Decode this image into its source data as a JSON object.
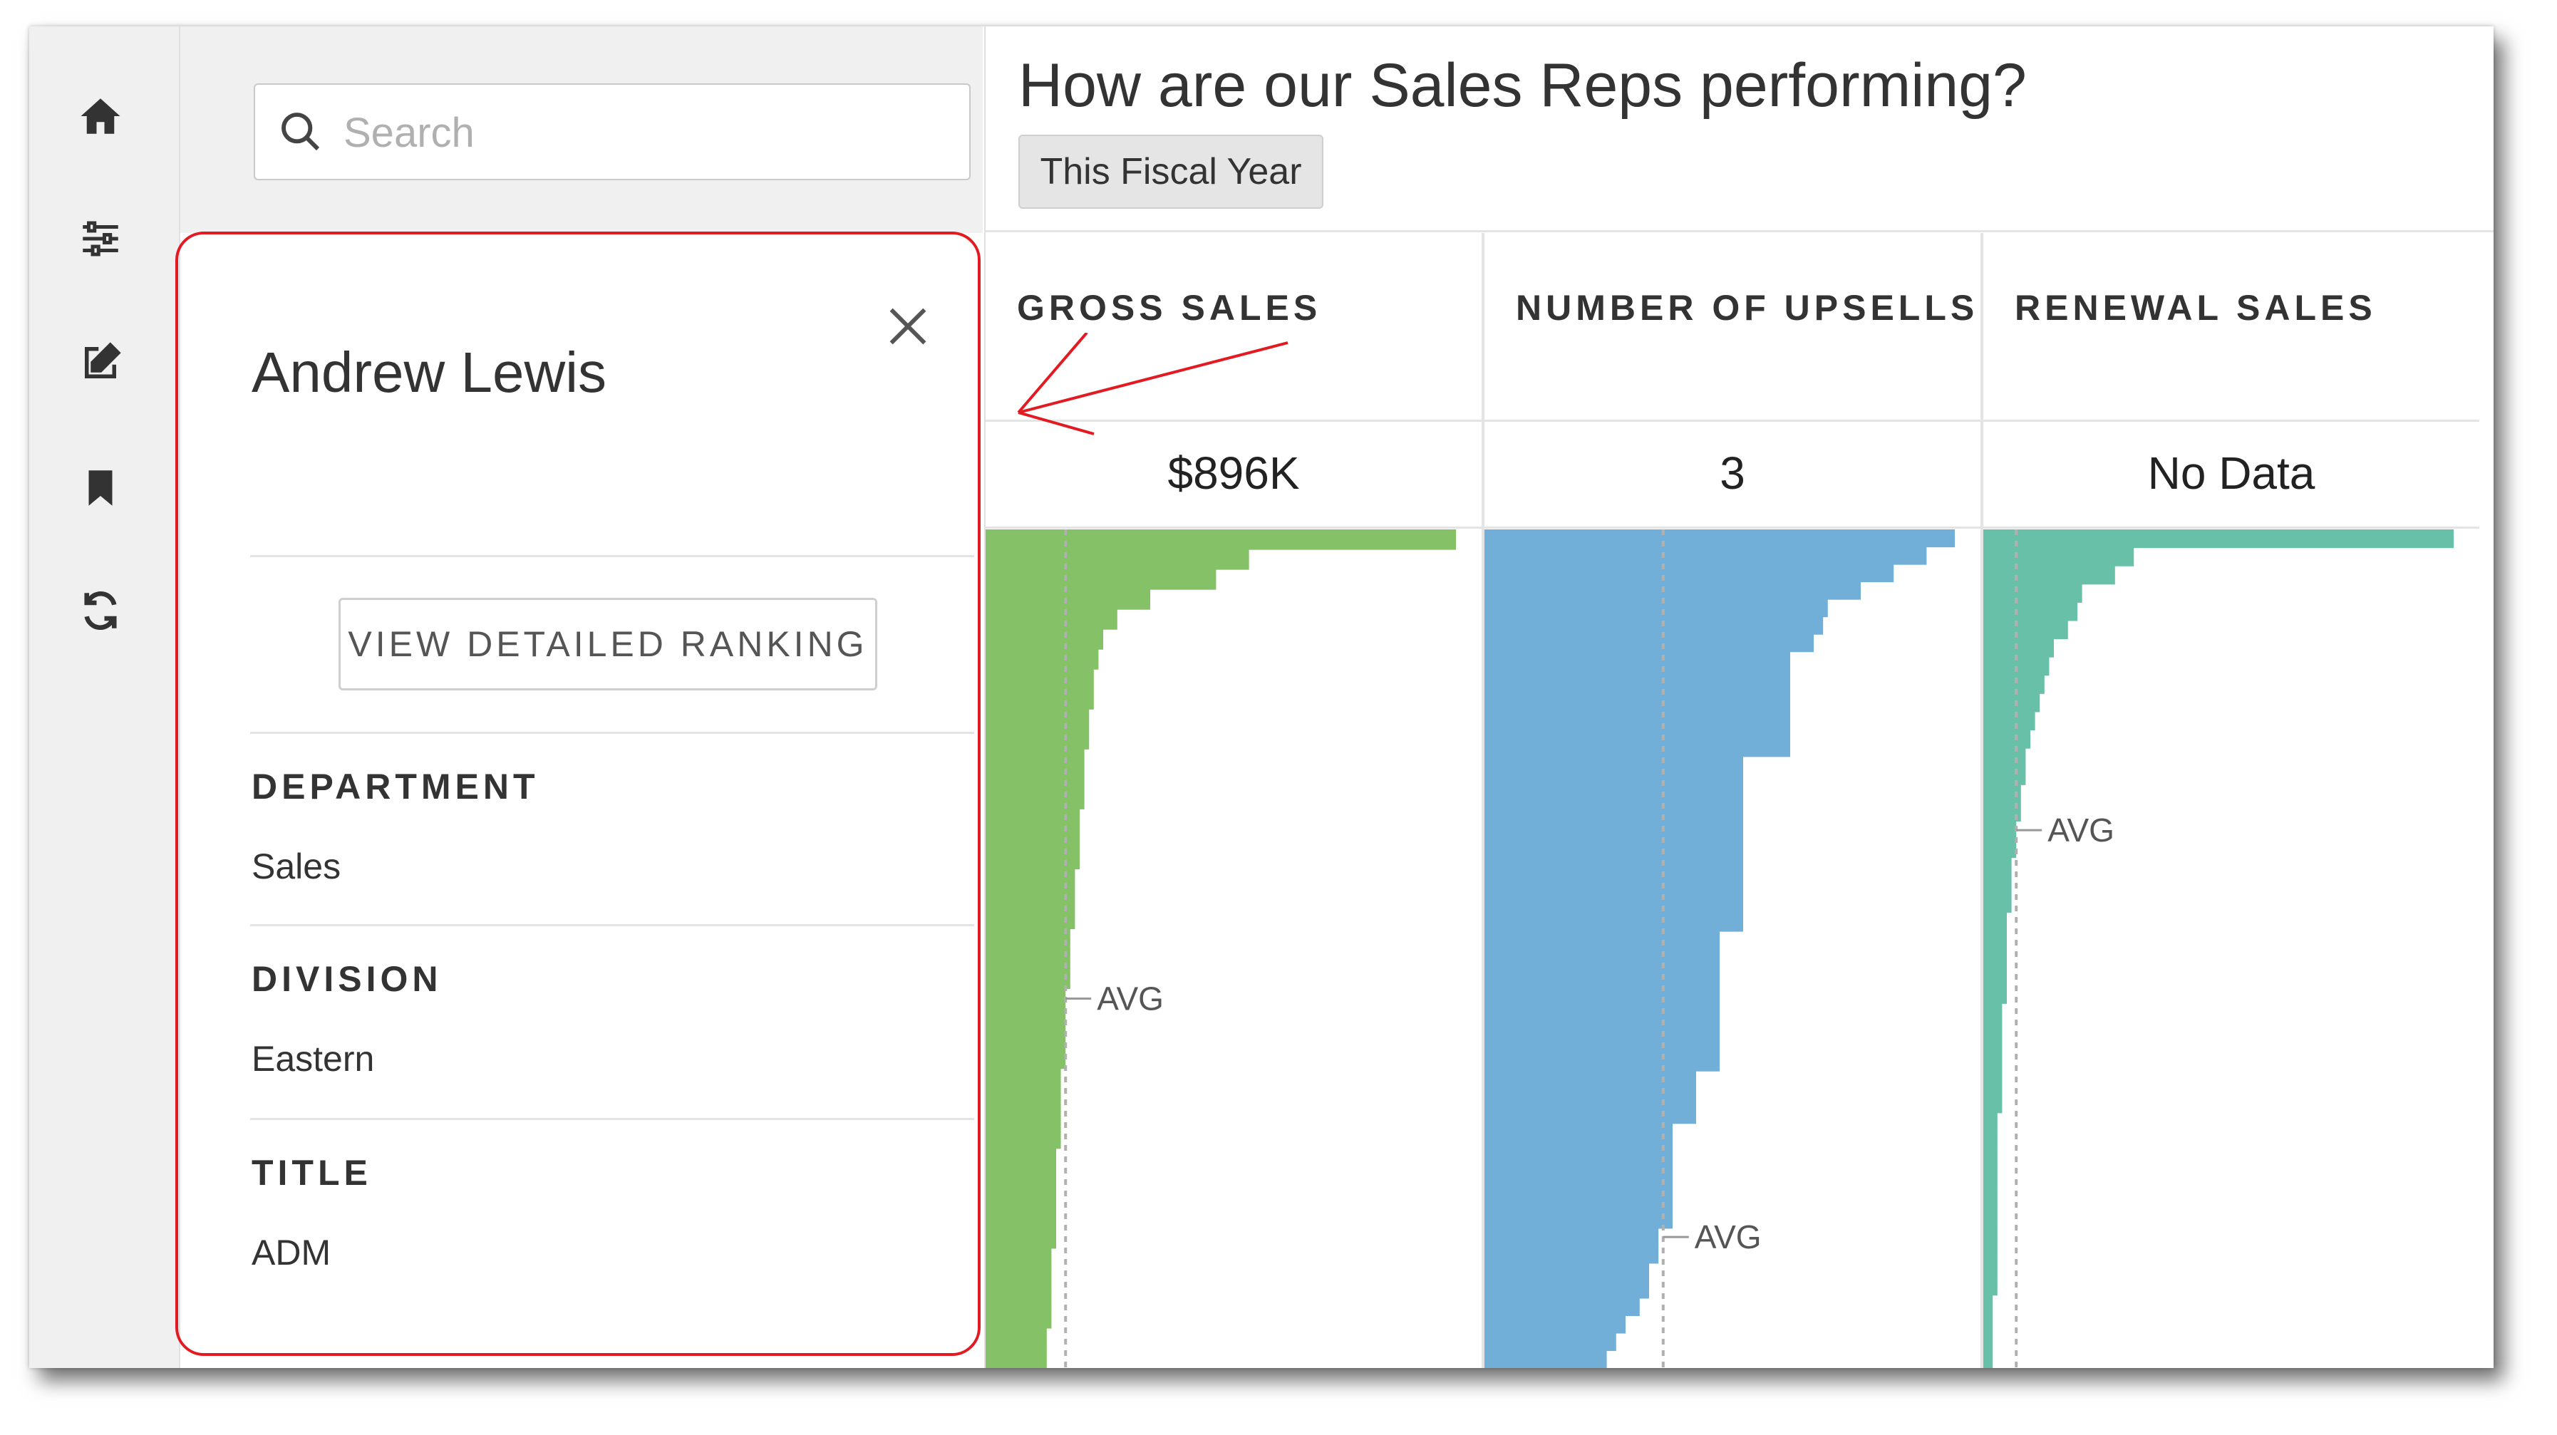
{
  "sidebar": {
    "icons": [
      "home-icon",
      "sliders-icon",
      "edit-icon",
      "bookmark-icon",
      "refresh-icon"
    ]
  },
  "search": {
    "placeholder": "Search"
  },
  "person": {
    "name": "Andrew Lewis",
    "ranking_button": "VIEW DETAILED RANKING",
    "fields": [
      {
        "label": "DEPARTMENT",
        "value": "Sales"
      },
      {
        "label": "DIVISION",
        "value": "Eastern"
      },
      {
        "label": "TITLE",
        "value": "ADM"
      }
    ]
  },
  "header": {
    "title": "How are our Sales Reps performing?",
    "period": "This Fiscal Year"
  },
  "metrics": [
    {
      "title": "GROSS SALES",
      "value": "$896K",
      "color": "#85c166"
    },
    {
      "title": "NUMBER OF UPSELLS",
      "value": "3",
      "color": "#72afd8"
    },
    {
      "title": "RENEWAL SALES",
      "value": "No Data",
      "color": "#68c0a8"
    }
  ],
  "chart_data": [
    {
      "type": "bar",
      "orientation": "horizontal-ranked",
      "title": "GROSS SALES",
      "avg_label": "AVG",
      "avg": 0.17,
      "values": [
        1.0,
        0.56,
        0.49,
        0.35,
        0.28,
        0.25,
        0.24,
        0.23,
        0.23,
        0.22,
        0.22,
        0.21,
        0.21,
        0.21,
        0.2,
        0.2,
        0.2,
        0.19,
        0.19,
        0.19,
        0.18,
        0.18,
        0.18,
        0.17,
        0.17,
        0.17,
        0.17,
        0.16,
        0.16,
        0.16,
        0.16,
        0.15,
        0.15,
        0.15,
        0.15,
        0.15,
        0.14,
        0.14,
        0.14,
        0.14,
        0.13,
        0.13
      ]
    },
    {
      "type": "bar",
      "orientation": "horizontal-ranked",
      "title": "NUMBER OF UPSELLS",
      "avg_label": "AVG",
      "avg": 0.38,
      "values": [
        1.0,
        0.94,
        0.87,
        0.8,
        0.73,
        0.72,
        0.7,
        0.65,
        0.65,
        0.65,
        0.65,
        0.65,
        0.65,
        0.55,
        0.55,
        0.55,
        0.55,
        0.55,
        0.55,
        0.55,
        0.55,
        0.55,
        0.55,
        0.5,
        0.5,
        0.5,
        0.5,
        0.5,
        0.5,
        0.5,
        0.5,
        0.45,
        0.45,
        0.45,
        0.4,
        0.4,
        0.4,
        0.4,
        0.4,
        0.4,
        0.37,
        0.37,
        0.35,
        0.35,
        0.33,
        0.3,
        0.28,
        0.26
      ],
      "tiers": [
        {
          "w": 1.0,
          "n": 1
        },
        {
          "w": 0.94,
          "n": 1
        },
        {
          "w": 0.88,
          "n": 1
        },
        {
          "w": 0.8,
          "n": 1
        },
        {
          "w": 0.75,
          "n": 1
        },
        {
          "w": 0.72,
          "n": 1
        },
        {
          "w": 0.71,
          "n": 1
        },
        {
          "w": 0.71,
          "n": 1
        },
        {
          "w": 0.64,
          "n": 3
        },
        {
          "w": 0.56,
          "n": 3
        },
        {
          "w": 0.55,
          "n": 1
        },
        {
          "w": 0.5,
          "n": 1
        },
        {
          "w": 0.45,
          "n": 2
        },
        {
          "w": 0.5,
          "n": 1
        },
        {
          "w": 0.47,
          "n": 2
        },
        {
          "w": 0.45,
          "n": 1
        },
        {
          "w": 0.43,
          "n": 1
        },
        {
          "w": 0.4,
          "n": 2
        },
        {
          "w": 0.38,
          "n": 4
        },
        {
          "w": 0.37,
          "n": 5
        },
        {
          "w": 0.36,
          "n": 2
        },
        {
          "w": 0.34,
          "n": 1
        },
        {
          "w": 0.33,
          "n": 1
        },
        {
          "w": 0.3,
          "n": 1
        },
        {
          "w": 0.27,
          "n": 1
        }
      ]
    },
    {
      "type": "bar",
      "orientation": "horizontal-ranked",
      "title": "RENEWAL SALES",
      "avg_label": "AVG",
      "avg": 0.07,
      "values": [
        1.0,
        0.32,
        0.28,
        0.21,
        0.2,
        0.18,
        0.15,
        0.14,
        0.13,
        0.12,
        0.11,
        0.1,
        0.09,
        0.09,
        0.08,
        0.08,
        0.07,
        0.07,
        0.06,
        0.06,
        0.06,
        0.05,
        0.05,
        0.05,
        0.05,
        0.05,
        0.04,
        0.04,
        0.04,
        0.04,
        0.04,
        0.04,
        0.03,
        0.03,
        0.03,
        0.03,
        0.03,
        0.03,
        0.03,
        0.03,
        0.03,
        0.03,
        0.02,
        0.02,
        0.02,
        0.02
      ]
    }
  ]
}
